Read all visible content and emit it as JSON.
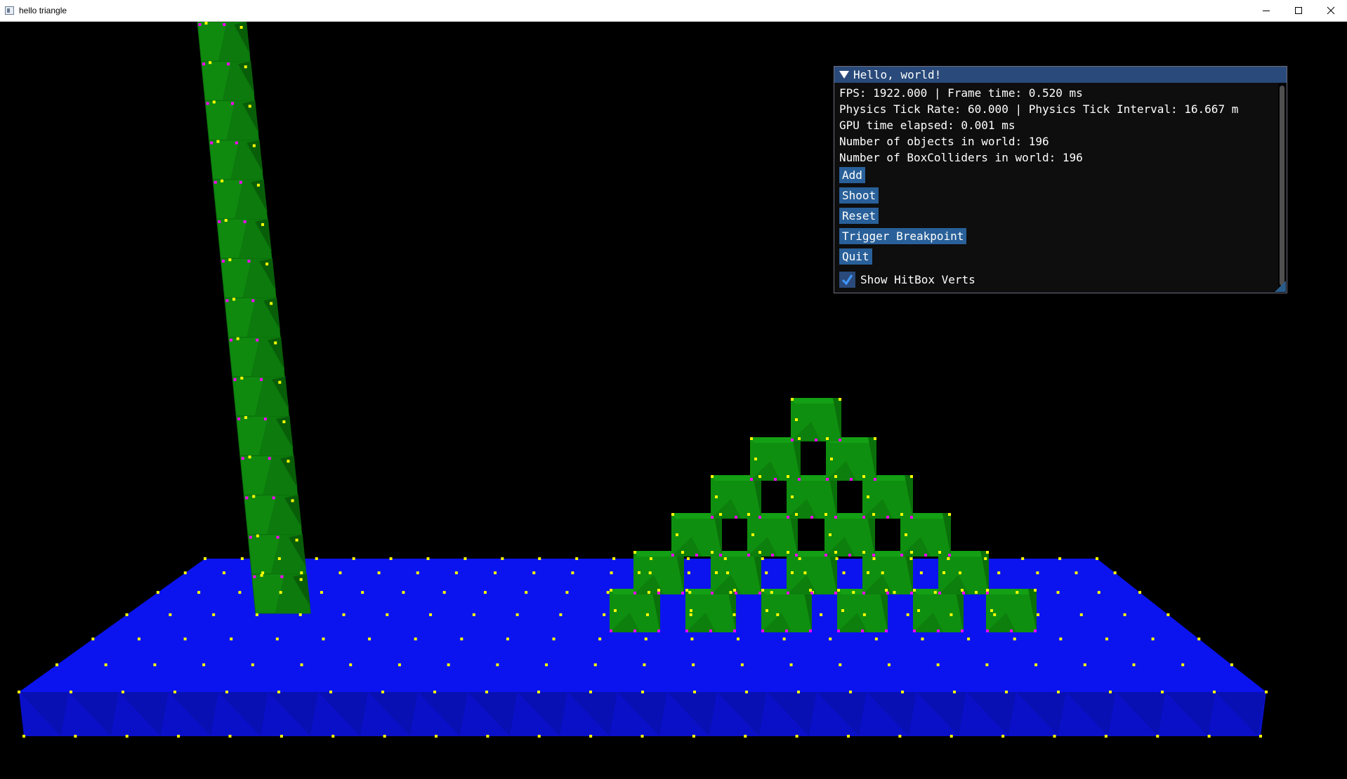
{
  "window": {
    "title": "hello triangle",
    "icon": "app-window-icon",
    "controls": [
      "minimize-icon",
      "maximize-icon",
      "close-icon"
    ]
  },
  "scene": {
    "background": "#000000",
    "floor_color": "#0a12e6",
    "box_color": "#0f8f0f",
    "vertex_colors": [
      "#ffff00",
      "#ff00ff"
    ]
  },
  "panel": {
    "title": "Hello, world!",
    "stats": [
      "FPS: 1922.000 | Frame time: 0.520 ms",
      "Physics Tick Rate: 60.000 | Physics Tick Interval: 16.667 m",
      "GPU time elapsed: 0.001 ms",
      "Number of objects in world: 196",
      "Number of BoxColliders in world: 196"
    ],
    "buttons": {
      "add": "Add",
      "shoot": "Shoot",
      "reset": "Reset",
      "trigger": "Trigger Breakpoint",
      "quit": "Quit"
    },
    "checkbox": {
      "label": "Show HitBox Verts",
      "checked": true
    },
    "accent": "#296099"
  }
}
